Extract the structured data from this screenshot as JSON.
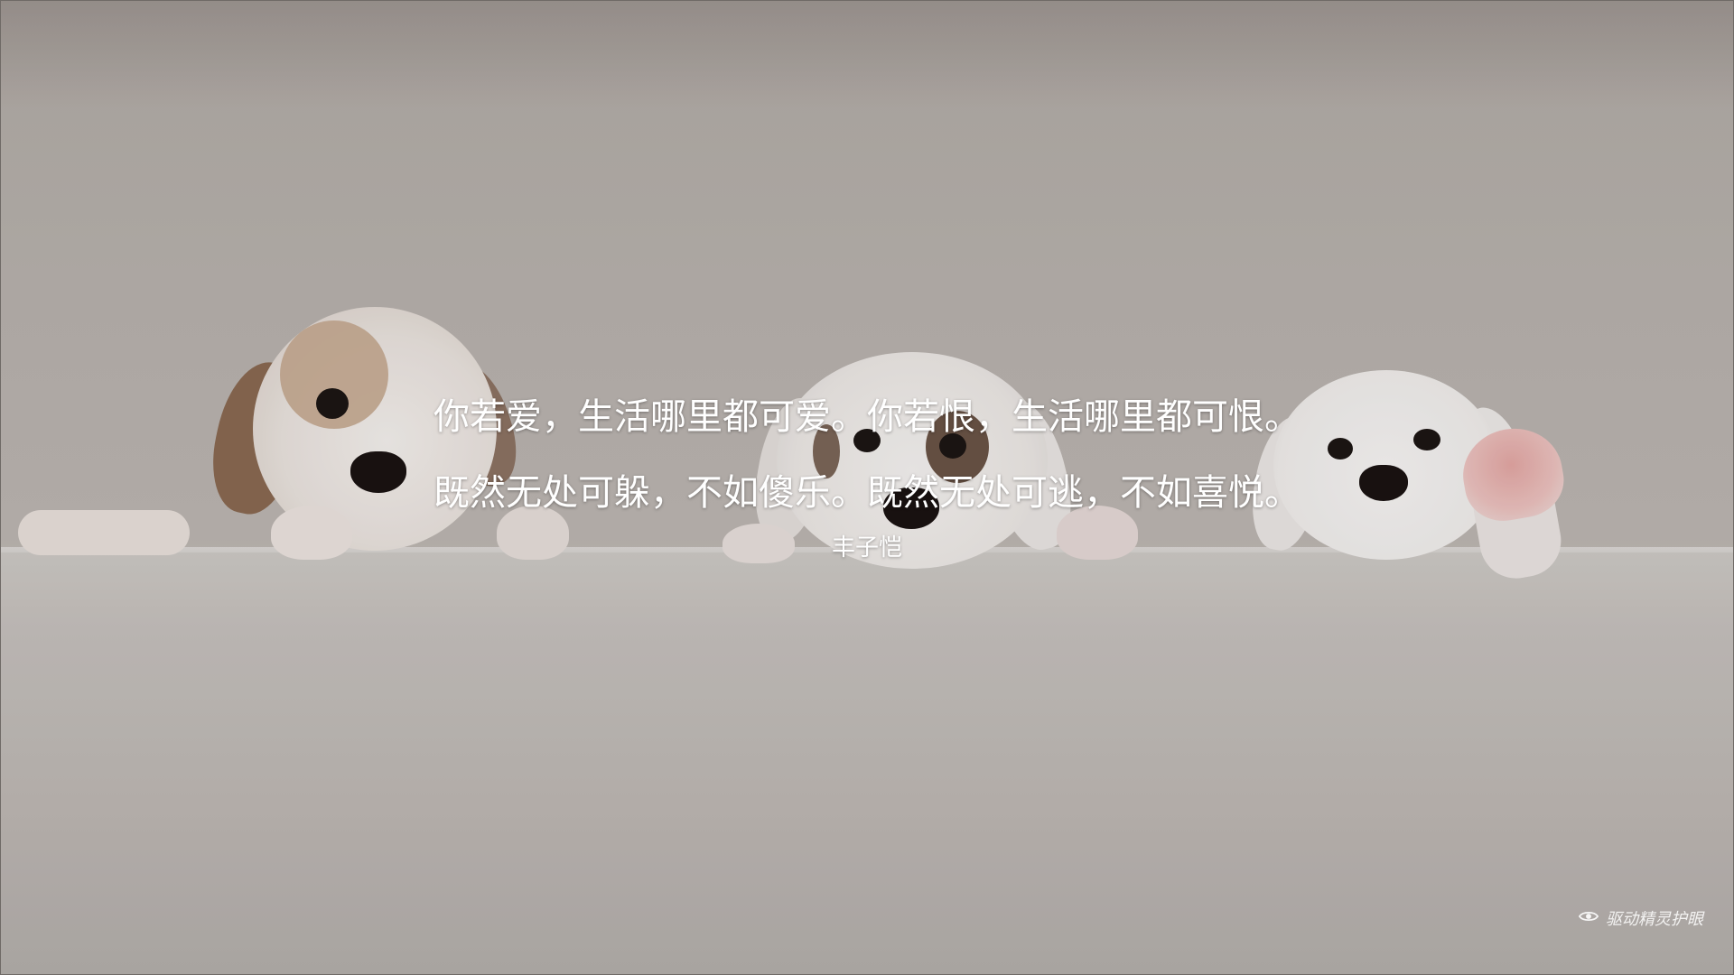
{
  "quote": {
    "line1": "你若爱，生活哪里都可爱。你若恨，生活哪里都可恨。",
    "line2": "既然无处可躲，不如傻乐。既然无处可逃，不如喜悦。",
    "author": "丰子恺"
  },
  "watermark": {
    "icon": "eye-icon",
    "label": "驱动精灵护眼"
  },
  "colors": {
    "text": "#ffffff",
    "background": "#b9b4af"
  }
}
